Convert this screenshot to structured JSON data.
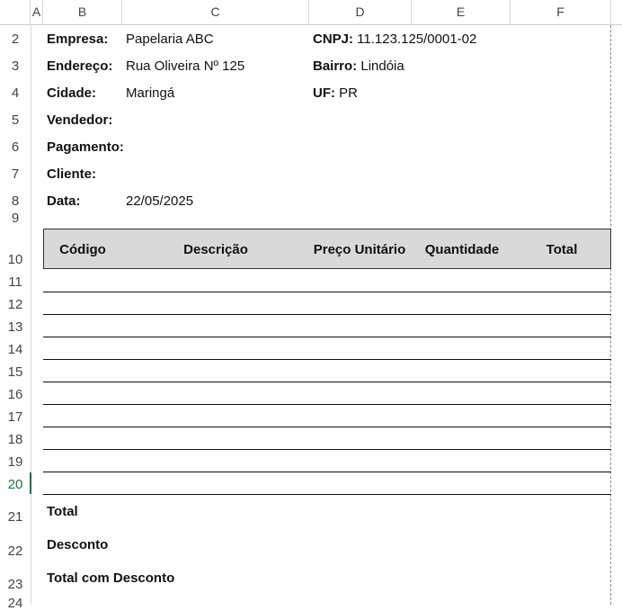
{
  "columns": [
    "A",
    "B",
    "C",
    "D",
    "E",
    "F"
  ],
  "rows": [
    "2",
    "3",
    "4",
    "5",
    "6",
    "7",
    "8",
    "9",
    "10",
    "11",
    "12",
    "13",
    "14",
    "15",
    "16",
    "17",
    "18",
    "19",
    "20",
    "21",
    "22",
    "23",
    "24"
  ],
  "selected_row": "20",
  "info": {
    "empresa_label": "Empresa:",
    "empresa_value": "Papelaria ABC",
    "cnpj_label": "CNPJ:",
    "cnpj_value": " 11.123.125/0001-02",
    "endereco_label": "Endereço:",
    "endereco_value": "Rua Oliveira Nº 125",
    "bairro_label": "Bairro:",
    "bairro_value": " Lindóia",
    "cidade_label": "Cidade:",
    "cidade_value": "Maringá",
    "uf_label": "UF:",
    "uf_value": " PR",
    "vendedor_label": "Vendedor:",
    "pagamento_label": "Pagamento:",
    "cliente_label": "Cliente:",
    "data_label": "Data:",
    "data_value": "22/05/2025"
  },
  "table": {
    "headers": [
      "Código",
      "Descrição",
      "Preço Unitário",
      "Quantidade",
      "Total"
    ]
  },
  "totals": {
    "total_label": "Total",
    "desconto_label": "Desconto",
    "total_desconto_label": "Total com Desconto"
  },
  "colors": {
    "header_fill": "#d9d9d9",
    "selected_row_accent": "#1e7145"
  }
}
